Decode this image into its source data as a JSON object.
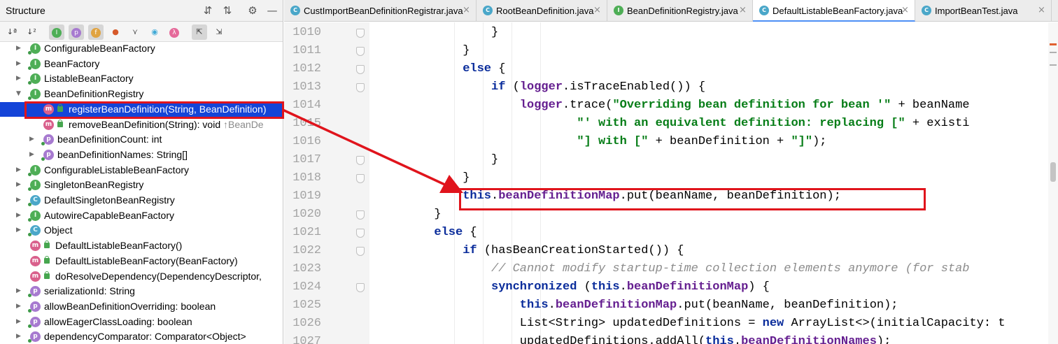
{
  "structure": {
    "title": "Structure",
    "header_icons": [
      "expand-all-icon",
      "collapse-all-icon",
      "gear-icon",
      "minimize-icon"
    ],
    "toolbar_icons": [
      "sort-alpha-icon",
      "sort-visibility-icon",
      "show-inherited-icon",
      "show-properties-icon",
      "show-fields-icon",
      "show-non-public-icon",
      "show-hierarchy-icon",
      "show-anonymous-icon",
      "show-lambdas-icon",
      "autoscroll-to-source-icon",
      "autoscroll-from-source-icon"
    ],
    "tree": [
      {
        "label": "ConfigurableBeanFactory",
        "kind": "interface",
        "arrow": "collapsed",
        "depth": 0
      },
      {
        "label": "BeanFactory",
        "kind": "interface",
        "arrow": "collapsed",
        "depth": 0
      },
      {
        "label": "ListableBeanFactory",
        "kind": "interface",
        "arrow": "collapsed",
        "depth": 0
      },
      {
        "label": "BeanDefinitionRegistry",
        "kind": "interface",
        "arrow": "expanded",
        "depth": 0
      },
      {
        "label": "registerBeanDefinition(String, BeanDefinition)",
        "suffix": "",
        "kind": "method",
        "depth": 1,
        "selected": true
      },
      {
        "label": "removeBeanDefinition(String): void",
        "suffix": " ↑BeanDe",
        "kind": "method",
        "depth": 1
      },
      {
        "label": "beanDefinitionCount: int",
        "kind": "property",
        "arrow": "collapsed",
        "depth": 1
      },
      {
        "label": "beanDefinitionNames: String[]",
        "kind": "property",
        "arrow": "collapsed",
        "depth": 1
      },
      {
        "label": "ConfigurableListableBeanFactory",
        "kind": "interface",
        "arrow": "collapsed",
        "depth": 0
      },
      {
        "label": "SingletonBeanRegistry",
        "kind": "interface",
        "arrow": "collapsed",
        "depth": 0
      },
      {
        "label": "DefaultSingletonBeanRegistry",
        "kind": "class",
        "arrow": "collapsed",
        "depth": 0
      },
      {
        "label": "AutowireCapableBeanFactory",
        "kind": "interface",
        "arrow": "collapsed",
        "depth": 0
      },
      {
        "label": "Object",
        "kind": "class",
        "arrow": "collapsed",
        "depth": 0
      },
      {
        "label": "DefaultListableBeanFactory()",
        "kind": "method",
        "depth": 0
      },
      {
        "label": "DefaultListableBeanFactory(BeanFactory)",
        "kind": "method",
        "depth": 0
      },
      {
        "label": "doResolveDependency(DependencyDescriptor,",
        "kind": "method",
        "depth": 0
      },
      {
        "label": "serializationId: String",
        "kind": "property",
        "arrow": "collapsed",
        "depth": 0
      },
      {
        "label": "allowBeanDefinitionOverriding: boolean",
        "kind": "property",
        "arrow": "collapsed",
        "depth": 0
      },
      {
        "label": "allowEagerClassLoading: boolean",
        "kind": "property",
        "arrow": "collapsed",
        "depth": 0
      },
      {
        "label": "dependencyComparator: Comparator<Object>",
        "kind": "property",
        "arrow": "collapsed",
        "depth": 0
      }
    ],
    "icon_letters": {
      "interface": "I",
      "class": "C",
      "method": "m",
      "property": "p"
    }
  },
  "tabs": [
    {
      "label": "CustImportBeanDefinitionRegistrar.java",
      "kind": "class",
      "active": false
    },
    {
      "label": "RootBeanDefinition.java",
      "kind": "class",
      "active": false
    },
    {
      "label": "BeanDefinitionRegistry.java",
      "kind": "interface",
      "active": false
    },
    {
      "label": "DefaultListableBeanFactory.java",
      "kind": "class",
      "active": true
    },
    {
      "label": "ImportBeanTest.java",
      "kind": "class",
      "active": false
    }
  ],
  "tab_close_glyph": "×",
  "editor": {
    "line_numbers": [
      "1010",
      "1011",
      "1012",
      "1013",
      "1014",
      "1015",
      "1016",
      "1017",
      "1018",
      "1019",
      "1020",
      "1021",
      "1022",
      "1023",
      "1024",
      "1025",
      "1026",
      "1027"
    ],
    "lines": [
      {
        "indent": 5,
        "tokens": [
          {
            "t": "}",
            "c": ""
          }
        ]
      },
      {
        "indent": 4,
        "tokens": [
          {
            "t": "}",
            "c": ""
          }
        ]
      },
      {
        "indent": 4,
        "tokens": [
          {
            "t": "else",
            "c": "kw"
          },
          {
            "t": " {",
            "c": ""
          }
        ]
      },
      {
        "indent": 5,
        "tokens": [
          {
            "t": "if",
            "c": "kw"
          },
          {
            "t": " (",
            "c": ""
          },
          {
            "t": "logger",
            "c": "fld"
          },
          {
            "t": ".isTraceEnabled()) {",
            "c": ""
          }
        ]
      },
      {
        "indent": 6,
        "tokens": [
          {
            "t": "logger",
            "c": "fld"
          },
          {
            "t": ".trace(",
            "c": ""
          },
          {
            "t": "\"Overriding bean definition for bean '\"",
            "c": "str"
          },
          {
            "t": " + beanName",
            "c": ""
          }
        ]
      },
      {
        "indent": 8,
        "tokens": [
          {
            "t": "\"' with an equivalent definition: replacing [\"",
            "c": "str"
          },
          {
            "t": " + existi",
            "c": ""
          }
        ]
      },
      {
        "indent": 8,
        "tokens": [
          {
            "t": "\"] with [\"",
            "c": "str"
          },
          {
            "t": " + beanDefinition + ",
            "c": ""
          },
          {
            "t": "\"]\"",
            "c": "str"
          },
          {
            "t": ");",
            "c": ""
          }
        ]
      },
      {
        "indent": 5,
        "tokens": [
          {
            "t": "}",
            "c": ""
          }
        ]
      },
      {
        "indent": 4,
        "tokens": [
          {
            "t": "}",
            "c": ""
          }
        ]
      },
      {
        "indent": 4,
        "tokens": [
          {
            "t": "this",
            "c": "kw"
          },
          {
            "t": ".",
            "c": ""
          },
          {
            "t": "beanDefinitionMap",
            "c": "fld"
          },
          {
            "t": ".put(beanName, beanDefinition);",
            "c": ""
          }
        ]
      },
      {
        "indent": 3,
        "tokens": [
          {
            "t": "}",
            "c": ""
          }
        ]
      },
      {
        "indent": 3,
        "tokens": [
          {
            "t": "else",
            "c": "kw"
          },
          {
            "t": " {",
            "c": ""
          }
        ]
      },
      {
        "indent": 4,
        "tokens": [
          {
            "t": "if",
            "c": "kw"
          },
          {
            "t": " (hasBeanCreationStarted()) {",
            "c": ""
          }
        ]
      },
      {
        "indent": 5,
        "tokens": [
          {
            "t": "// Cannot modify startup-time collection elements anymore (for stab",
            "c": "cmt"
          }
        ]
      },
      {
        "indent": 5,
        "tokens": [
          {
            "t": "synchronized",
            "c": "kw"
          },
          {
            "t": " (",
            "c": ""
          },
          {
            "t": "this",
            "c": "kw"
          },
          {
            "t": ".",
            "c": ""
          },
          {
            "t": "beanDefinitionMap",
            "c": "fld"
          },
          {
            "t": ") {",
            "c": ""
          }
        ]
      },
      {
        "indent": 6,
        "tokens": [
          {
            "t": "this",
            "c": "kw"
          },
          {
            "t": ".",
            "c": ""
          },
          {
            "t": "beanDefinitionMap",
            "c": "fld"
          },
          {
            "t": ".put(beanName, beanDefinition);",
            "c": ""
          }
        ]
      },
      {
        "indent": 6,
        "tokens": [
          {
            "t": "List<String> updatedDefinitions = ",
            "c": ""
          },
          {
            "t": "new",
            "c": "kw"
          },
          {
            "t": " ArrayList<>(initialCapacity: t",
            "c": ""
          }
        ]
      },
      {
        "indent": 6,
        "tokens": [
          {
            "t": "updatedDefinitions.addAll(",
            "c": ""
          },
          {
            "t": "this",
            "c": "kw"
          },
          {
            "t": ".",
            "c": ""
          },
          {
            "t": "beanDefinitionNames",
            "c": "fld"
          },
          {
            "t": ");",
            "c": ""
          }
        ]
      }
    ],
    "highlighted_line": "1019"
  },
  "colors": {
    "selection": "#1444d8",
    "annotation_red": "#e0141c",
    "keyword": "#0a2c9b",
    "field": "#651f90",
    "string": "#067d17"
  },
  "annotations": [
    "red-box-selected-method",
    "red-box-code-line-1019",
    "red-arrow-connector"
  ]
}
